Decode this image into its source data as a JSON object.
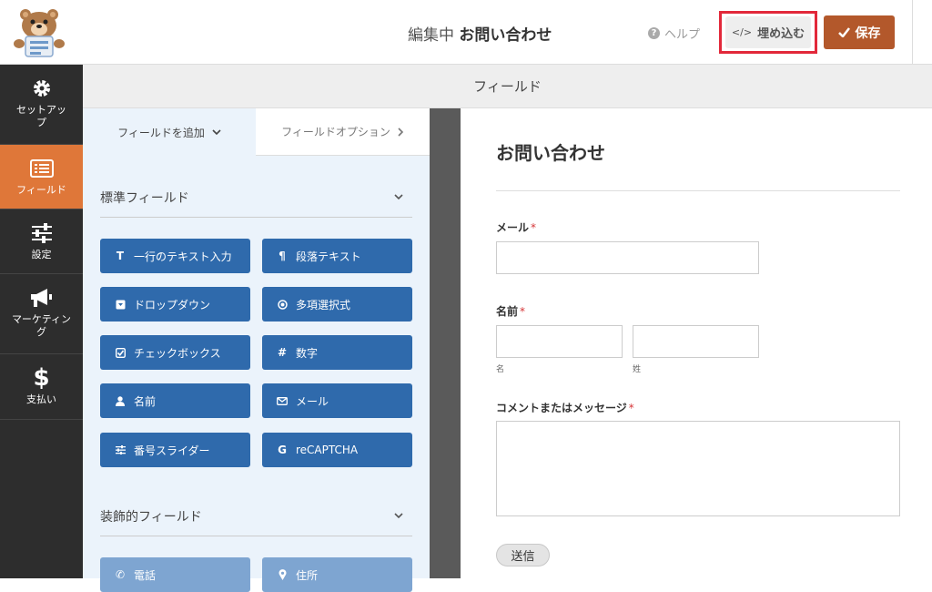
{
  "header": {
    "editing_label": "編集中",
    "form_name": "お問い合わせ",
    "help_label": "ヘルプ",
    "embed_label": "埋め込む",
    "save_label": "保存"
  },
  "sidebar": {
    "items": [
      {
        "label": "セットアップ",
        "icon": "gear-icon"
      },
      {
        "label": "フィールド",
        "icon": "list-icon"
      },
      {
        "label": "設定",
        "icon": "sliders-icon"
      },
      {
        "label": "マーケティング",
        "icon": "megaphone-icon"
      },
      {
        "label": "支払い",
        "icon": "dollar-icon"
      }
    ],
    "active_color": "#df7739"
  },
  "section_title": "フィールド",
  "tabs": {
    "add_fields": "フィールドを追加",
    "field_options": "フィールドオプション"
  },
  "standard_fields": {
    "heading": "標準フィールド",
    "buttons": [
      {
        "label": "一行のテキスト入力",
        "icon": "text-icon"
      },
      {
        "label": "段落テキスト",
        "icon": "paragraph-icon"
      },
      {
        "label": "ドロップダウン",
        "icon": "dropdown-icon"
      },
      {
        "label": "多項選択式",
        "icon": "radio-icon"
      },
      {
        "label": "チェックボックス",
        "icon": "checkbox-icon"
      },
      {
        "label": "数字",
        "icon": "hash-icon"
      },
      {
        "label": "名前",
        "icon": "user-icon"
      },
      {
        "label": "メール",
        "icon": "envelope-icon"
      },
      {
        "label": "番号スライダー",
        "icon": "sliders-icon"
      },
      {
        "label": "reCAPTCHA",
        "icon": "recaptcha-icon"
      }
    ]
  },
  "fancy_fields": {
    "heading": "装飾的フィールド",
    "buttons": [
      {
        "label": "電話",
        "icon": "phone-icon"
      },
      {
        "label": "住所",
        "icon": "map-pin-icon"
      }
    ]
  },
  "preview": {
    "title": "お問い合わせ",
    "email_label": "メール",
    "name_label": "名前",
    "first_sublabel": "名",
    "last_sublabel": "姓",
    "message_label": "コメントまたはメッセージ",
    "required_mark": "*",
    "submit_label": "送信"
  },
  "colors": {
    "field_button": "#2f6aac",
    "save_button": "#b3582b",
    "highlight_box": "#e2283a"
  }
}
